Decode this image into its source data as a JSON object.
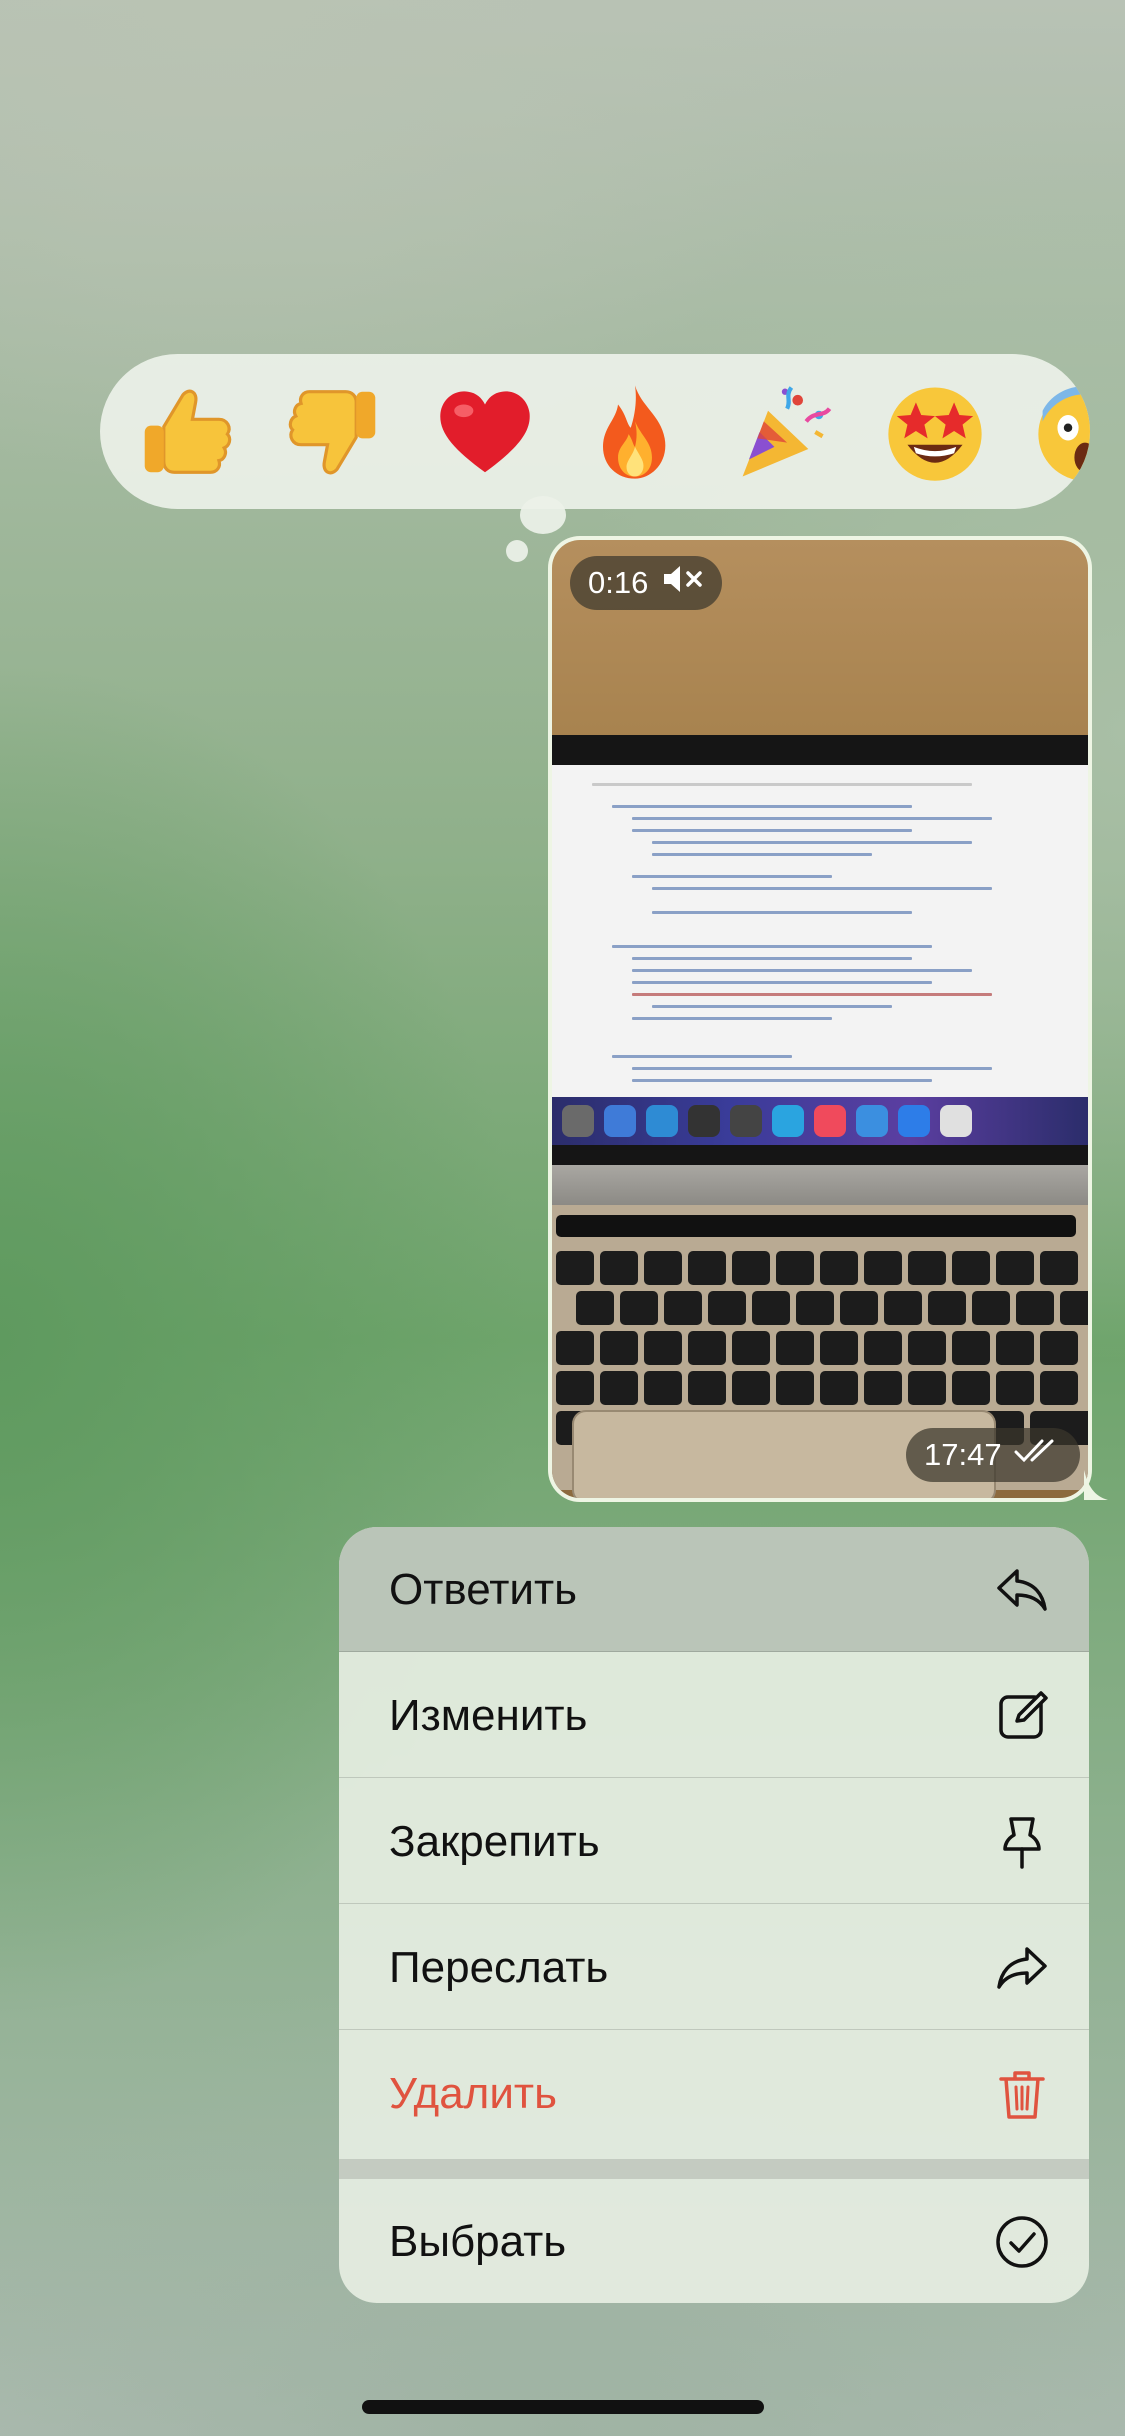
{
  "reactions": [
    {
      "name": "thumbs-up-icon"
    },
    {
      "name": "thumbs-down-icon"
    },
    {
      "name": "red-heart-icon"
    },
    {
      "name": "fire-icon"
    },
    {
      "name": "party-popper-icon"
    },
    {
      "name": "star-struck-icon"
    },
    {
      "name": "screaming-face-icon"
    }
  ],
  "video": {
    "duration": "0:16",
    "timestamp": "17:47",
    "muted_icon": "speaker-muted-icon",
    "read_icon": "double-check-icon"
  },
  "menu": {
    "items": [
      {
        "label": "Ответить",
        "icon": "reply-icon"
      },
      {
        "label": "Изменить",
        "icon": "edit-icon"
      },
      {
        "label": "Закрепить",
        "icon": "pin-icon"
      },
      {
        "label": "Переслать",
        "icon": "forward-icon"
      },
      {
        "label": "Удалить",
        "icon": "trash-icon"
      },
      {
        "label": "Выбрать",
        "icon": "select-check-icon"
      }
    ]
  },
  "colors": {
    "danger": "#e0533f",
    "menu_bg": "#e6eee2",
    "reaction_bar_bg": "#ecf1e8"
  }
}
